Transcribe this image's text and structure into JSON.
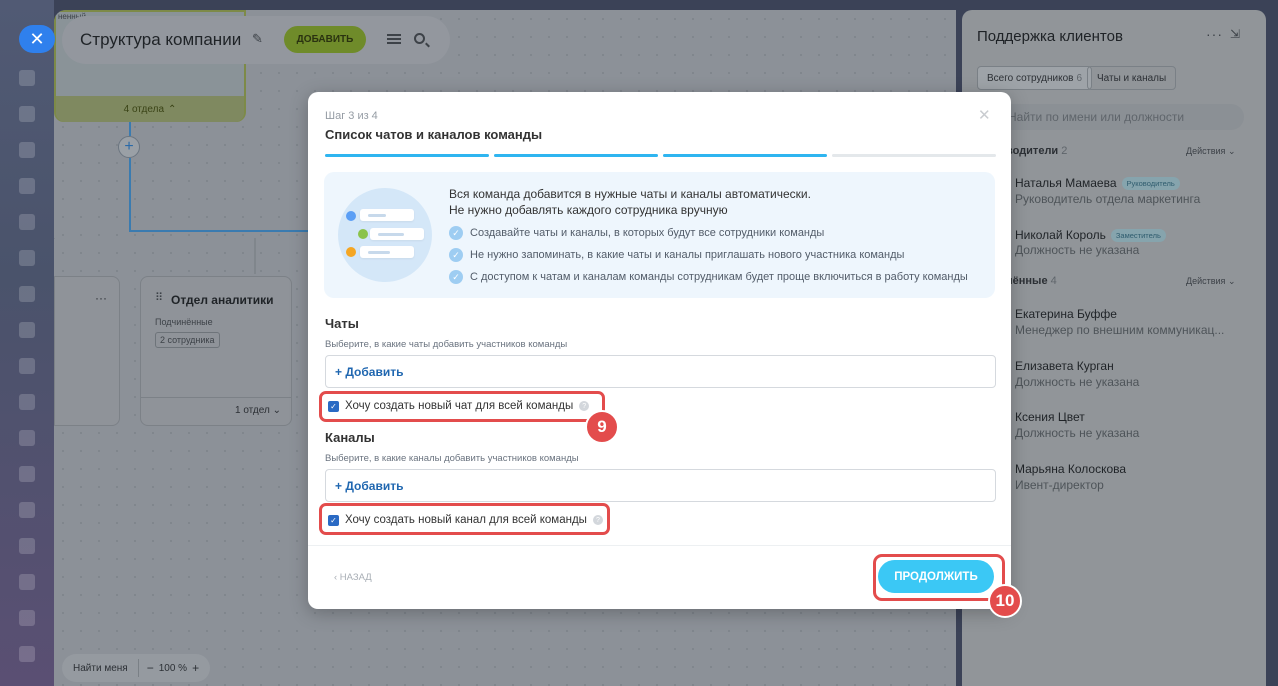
{
  "slider": {
    "page_title": "Структура компании",
    "add_label": "ДОБАВИТЬ",
    "top_node_footer": "4 отдела",
    "dept_card_name": "Отдел аналитики",
    "dept_card_sub": "Подчинённые",
    "dept_card_badge": "2 сотрудника",
    "dept_card_footer": "1 отдел",
    "left_card_more": "···",
    "find_me_label": "Найти меня",
    "zoom_minus": "−",
    "zoom_level": "100 %",
    "zoom_plus": "+",
    "top_partial_text": "ненный"
  },
  "right_panel": {
    "title": "Поддержка клиентов",
    "tabs": [
      {
        "label": "Всего сотрудников",
        "count": "6"
      },
      {
        "label": "Чаты и каналы"
      }
    ],
    "search_placeholder": "Найти по имени или должности",
    "sections": [
      {
        "title": "водители",
        "count": "2",
        "actions": "Действия"
      },
      {
        "title": "нённые",
        "count": "4",
        "actions": "Действия"
      }
    ],
    "people": [
      {
        "name": "Наталья Мамаева",
        "tag": "Руководитель",
        "role": "Руководитель отдела маркетинга"
      },
      {
        "name": "Николай Король",
        "tag": "Заместитель",
        "role": "Должность не указана"
      },
      {
        "name": "Екатерина Буффе",
        "tag": "",
        "role": "Менеджер по внешним коммуникац..."
      },
      {
        "name": "Елизавета Курган",
        "tag": "",
        "role": "Должность не указана"
      },
      {
        "name": "Ксения Цвет",
        "tag": "",
        "role": "Должность не указана"
      },
      {
        "name": "Марьяна Колоскова",
        "tag": "",
        "role": "Ивент-директор"
      }
    ]
  },
  "modal": {
    "step_label": "Шаг 3 из 4",
    "title": "Список чатов и каналов команды",
    "steps_total": 4,
    "steps_done": 3,
    "info_heading_1": "Вся команда добавится в нужные чаты и каналы автоматически.",
    "info_heading_2": "Не нужно добавлять каждого сотрудника вручную",
    "bullets": [
      "Создавайте чаты и каналы, в которых будут все сотрудники команды",
      "Не нужно запоминать, в какие чаты и каналы приглашать нового участника команды",
      "С доступом к чатам и каналам команды сотрудникам будет проще включиться в работу команды"
    ],
    "chats": {
      "title": "Чаты",
      "hint": "Выберите, в какие чаты добавить участников команды",
      "add_label": "+ Добавить",
      "checkbox_label": "Хочу создать новый чат для всей команды",
      "checked": true
    },
    "channels": {
      "title": "Каналы",
      "hint": "Выберите, в какие каналы добавить участников команды",
      "add_label": "+ Добавить",
      "checkbox_label": "Хочу создать новый канал для всей команды",
      "checked": true
    },
    "back_label": "‹ НАЗАД",
    "continue_label": "ПРОДОЛЖИТЬ"
  },
  "markers": [
    "9",
    "10"
  ],
  "colors": {
    "accent": "#3bc8f5",
    "progress": "#2fb5f0",
    "highlight": "#e34c4c",
    "link": "#2067b0"
  }
}
